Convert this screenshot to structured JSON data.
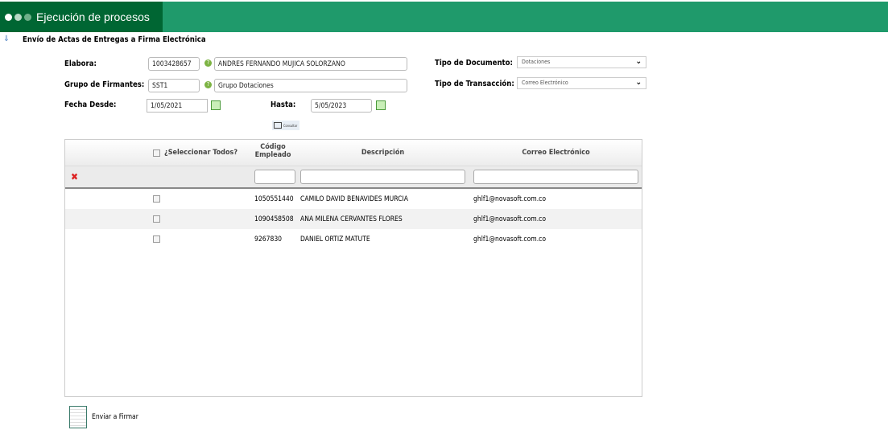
{
  "header": {
    "title": "Ejecución de procesos"
  },
  "page": {
    "title": "Envío de Actas de Entregas a Firma Electrónica"
  },
  "form": {
    "elabora": {
      "label": "Elabora:",
      "code": "1003428657",
      "name": "ANDRES FERNANDO MUJICA SOLORZANO"
    },
    "grupo": {
      "label": "Grupo de Firmantes:",
      "code": "SST1",
      "name": "Grupo Dotaciones"
    },
    "fecha_desde": {
      "label": "Fecha Desde:",
      "value": "1/05/2021"
    },
    "hasta": {
      "label": "Hasta:",
      "value": "5/05/2023"
    },
    "tipo_documento": {
      "label": "Tipo de Documento:",
      "value": "Dotaciones"
    },
    "tipo_transaccion": {
      "label": "Tipo de Transacción:",
      "value": "Correo Electrónico"
    },
    "consultar": "Consultar"
  },
  "grid": {
    "columns": {
      "select_all": "¿Seleccionar Todos?",
      "codigo": "Código Empleado",
      "descripcion": "Descripción",
      "correo": "Correo Electrónico"
    },
    "rows": [
      {
        "codigo": "1050551440",
        "descripcion": "CAMILO DAVID BENAVIDES MURCIA",
        "correo": "ghlf1@novasoft.com.co"
      },
      {
        "codigo": "1090458508",
        "descripcion": "ANA MILENA CERVANTES FLORES",
        "correo": "ghlf1@novasoft.com.co"
      },
      {
        "codigo": "9267830",
        "descripcion": "DANIEL ORTIZ MATUTE",
        "correo": "ghlf1@novasoft.com.co"
      }
    ]
  },
  "footer": {
    "send": "Enviar a Firmar"
  },
  "colors": {
    "header_dark": "#006633",
    "header": "#1f9a6b"
  }
}
